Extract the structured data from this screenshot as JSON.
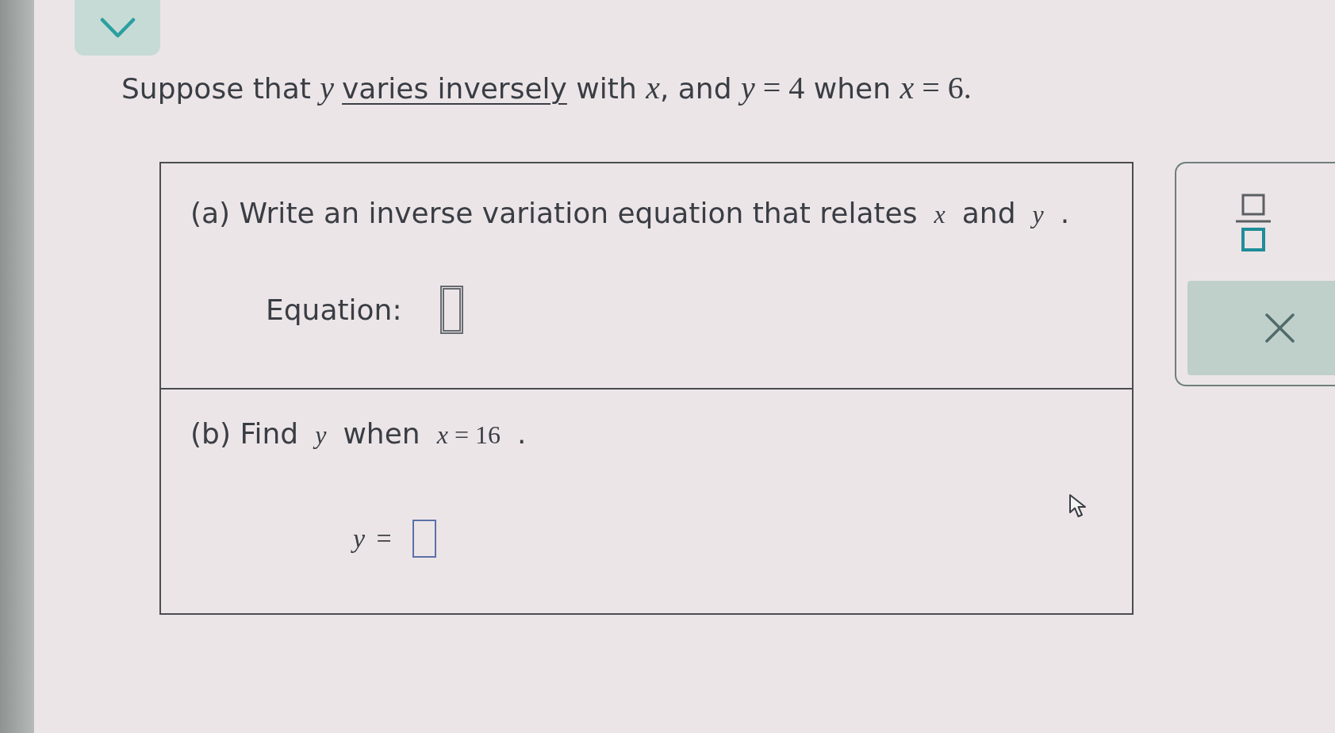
{
  "question": {
    "segments": [
      {
        "kind": "text",
        "text": "Suppose that "
      },
      {
        "kind": "math",
        "text": "*y* "
      },
      {
        "kind": "link",
        "text": "varies inversely"
      },
      {
        "kind": "text",
        "text": " with "
      },
      {
        "kind": "math",
        "text": "*x*"
      },
      {
        "kind": "text",
        "text": ", and "
      },
      {
        "kind": "math",
        "text": "*y* = 4"
      },
      {
        "kind": "text",
        "text": " when "
      },
      {
        "kind": "math",
        "text": "*x* = 6."
      }
    ]
  },
  "parts": [
    {
      "prompt": [
        {
          "kind": "text",
          "text": "(a) Write an inverse variation equation that relates "
        },
        {
          "kind": "math",
          "text": "*x*"
        },
        {
          "kind": "text",
          "text": " and "
        },
        {
          "kind": "math",
          "text": "*y*"
        },
        {
          "kind": "text",
          "text": " ."
        }
      ],
      "answer_label": {
        "kind": "text",
        "text": "Equation:"
      },
      "answer": {
        "focused": true
      }
    },
    {
      "prompt": [
        {
          "kind": "text",
          "text": "(b) Find "
        },
        {
          "kind": "math",
          "text": "*y*"
        },
        {
          "kind": "text",
          "text": " when "
        },
        {
          "kind": "math",
          "text": "*x* = 16"
        },
        {
          "kind": "text",
          "text": " ."
        }
      ],
      "answer_label": {
        "kind": "math",
        "text": "*y* ="
      },
      "answer": {
        "focused": false
      }
    }
  ]
}
